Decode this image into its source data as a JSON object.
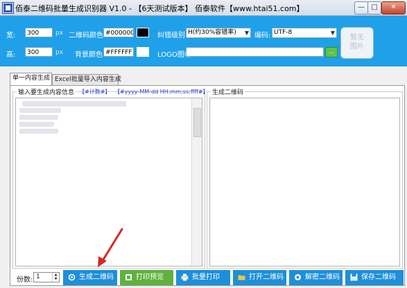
{
  "window": {
    "title": "佰泰二维码批量生成识别器 V1.0 - 【6天测试版本】 佰泰软件【www.htai51.com】",
    "min_glyph": "—",
    "max_glyph": "□",
    "close_glyph": "✕"
  },
  "settings": {
    "width_label": "宽:",
    "width_value": "300",
    "width_unit": "px",
    "height_label": "高:",
    "height_value": "300",
    "height_unit": "px",
    "qr_color_label": "二维码颜色:",
    "qr_color_value": "#000000",
    "qr_color_swatch": "#000000",
    "bg_color_label": "背景颜色:",
    "bg_color_value": "#FFFFFF",
    "bg_color_swatch": "#FFFFFF",
    "ecc_label": "纠错级别:",
    "ecc_value": "H(约30%容错率)",
    "encoding_label": "编码:",
    "encoding_value": "UTF-8",
    "logo_label": "LOGO图标:",
    "logo_value": "",
    "browse_label": "...",
    "logo_placeholder_line1": "暂无",
    "logo_placeholder_line2": "图片"
  },
  "tabs": [
    {
      "label": "单一内容生成",
      "active": true
    },
    {
      "label": "Excel批量导入内容生成",
      "active": false
    }
  ],
  "input_group": {
    "label": "输入要生成内容信息",
    "counter_link": "【#计数#】",
    "datetime_link": "【#yyyy-MM-dd HH:mm:ss:ffff#】"
  },
  "output_group": {
    "label": "生成二维码"
  },
  "bottom": {
    "copies_label": "份数:",
    "copies_value": "1",
    "buttons": [
      {
        "label": "生成二维码",
        "icon": "qr-gear-icon"
      },
      {
        "label": "打印预览",
        "icon": "print-preview-icon"
      },
      {
        "label": "批量打印",
        "icon": "printer-icon"
      },
      {
        "label": "打开二维码",
        "icon": "folder-open-icon"
      },
      {
        "label": "解密二维码",
        "icon": "decode-icon"
      },
      {
        "label": "保存二维码",
        "icon": "save-icon"
      }
    ]
  },
  "colors": {
    "accent_blue": "#1fa0e8",
    "button_blue": "#1e8fd8",
    "button_green": "#5eb23c",
    "annotation_arrow": "#d32a1e"
  }
}
